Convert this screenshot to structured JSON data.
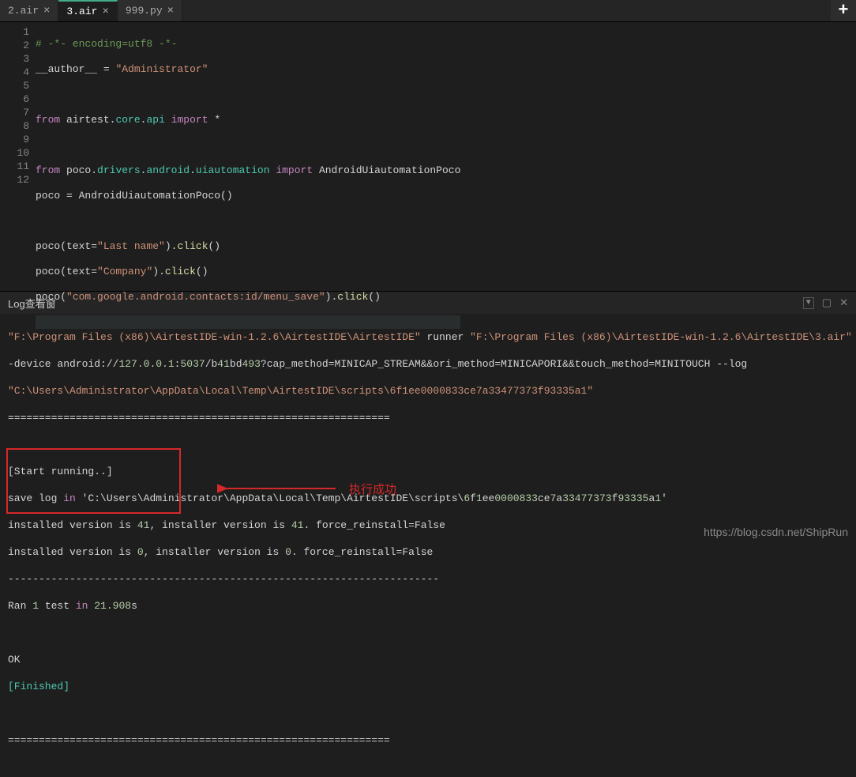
{
  "tabs": [
    {
      "label": "2.air",
      "active": false
    },
    {
      "label": "3.air",
      "active": true
    },
    {
      "label": "999.py",
      "active": false
    }
  ],
  "code": {
    "lines": [
      "# -*- encoding=utf8 -*-",
      "__author__ = \"Administrator\"",
      "",
      "from airtest.core.api import *",
      "",
      "from poco.drivers.android.uiautomation import AndroidUiautomationPoco",
      "poco = AndroidUiautomationPoco()",
      "",
      "poco(text=\"Last name\").click()",
      "poco(text=\"Company\").click()",
      "poco(\"com.google.android.contacts:id/menu_save\").click()",
      ""
    ]
  },
  "panel": {
    "title": "Log查看窗"
  },
  "log": {
    "exe1": "\"F:\\Program Files (x86)\\AirtestIDE-win-1.2.6\\AirtestIDE\\AirtestIDE\"",
    "runner": " runner ",
    "exe2": "\"F:\\Program Files (x86)\\AirtestIDE-win-1.2.6\\AirtestIDE\\3.air\"",
    "dev_prefix": "-device android://",
    "ip": "127.0.0.1",
    "colon": ":",
    "port": "5037",
    "slash": "/b",
    "h1": "41",
    "mid1": "bd",
    "h2": "493",
    "qs": "?cap_method=MINICAP_STREAM&&ori_method=MINICAPORI&&touch_method=MINITOUCH --log",
    "logpath": "\"C:\\Users\\Administrator\\AppData\\Local\\Temp\\AirtestIDE\\scripts\\6f1ee0000833ce7a33477373f93335a1\"",
    "eq": "==============================================================",
    "start": "[Start running..]",
    "save_prefix": "save log ",
    "in": "in",
    "save_path_a": " 'C:\\Users\\Administrator\\AppData\\Local\\Temp\\AirtestIDE\\scripts\\",
    "hx1": "6",
    "hx2": "f",
    "hx3": "1",
    "hx4": "ee",
    "hx5": "0000833",
    "hx6": "ce",
    "hx7": "7",
    "hx8": "a",
    "hx9": "33477373",
    "hx10": "f",
    "hx11": "93335",
    "hx12": "a",
    "hx13": "1",
    "save_path_b": "'",
    "inst1a": "installed version is ",
    "v41": "41",
    "inst1b": ", installer version is ",
    "inst1c": ". force_reinstall=False",
    "v0": "0",
    "dash": "----------------------------------------------------------------------",
    "ran": "Ran ",
    "one": "1",
    "test": " test ",
    "secs": "21.908",
    "s": "s",
    "ok": "OK",
    "finished": "[Finished]"
  },
  "annotation": "执行成功",
  "watermark": "https://blog.csdn.net/ShipRun"
}
